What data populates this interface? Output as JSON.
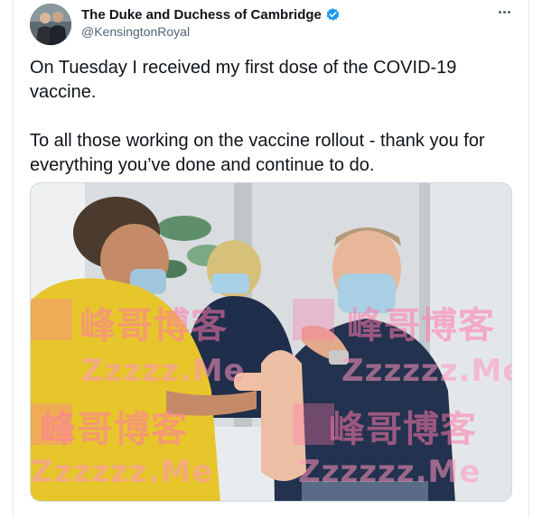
{
  "tweet": {
    "author_name": "The Duke and Duchess of Cambridge",
    "author_handle": "@KensingtonRoyal",
    "verified": true,
    "paragraphs": [
      "On Tuesday I received my first dose of the COVID-19 vaccine.",
      "To all those working on the vaccine rollout - thank you for everything you’ve done and continue to do."
    ]
  },
  "watermark": {
    "chinese_text": "峰哥博客",
    "latin_text": "Zzzzzz.Me",
    "latin_text_short": "Zzzzz.Me"
  },
  "colors": {
    "verified_blue": "#1d9bf0",
    "text_primary": "#0f1419",
    "text_secondary": "#536471",
    "watermark_pink": "#ff78aa"
  },
  "icons": [
    "verified-badge-icon",
    "more-options-icon"
  ]
}
